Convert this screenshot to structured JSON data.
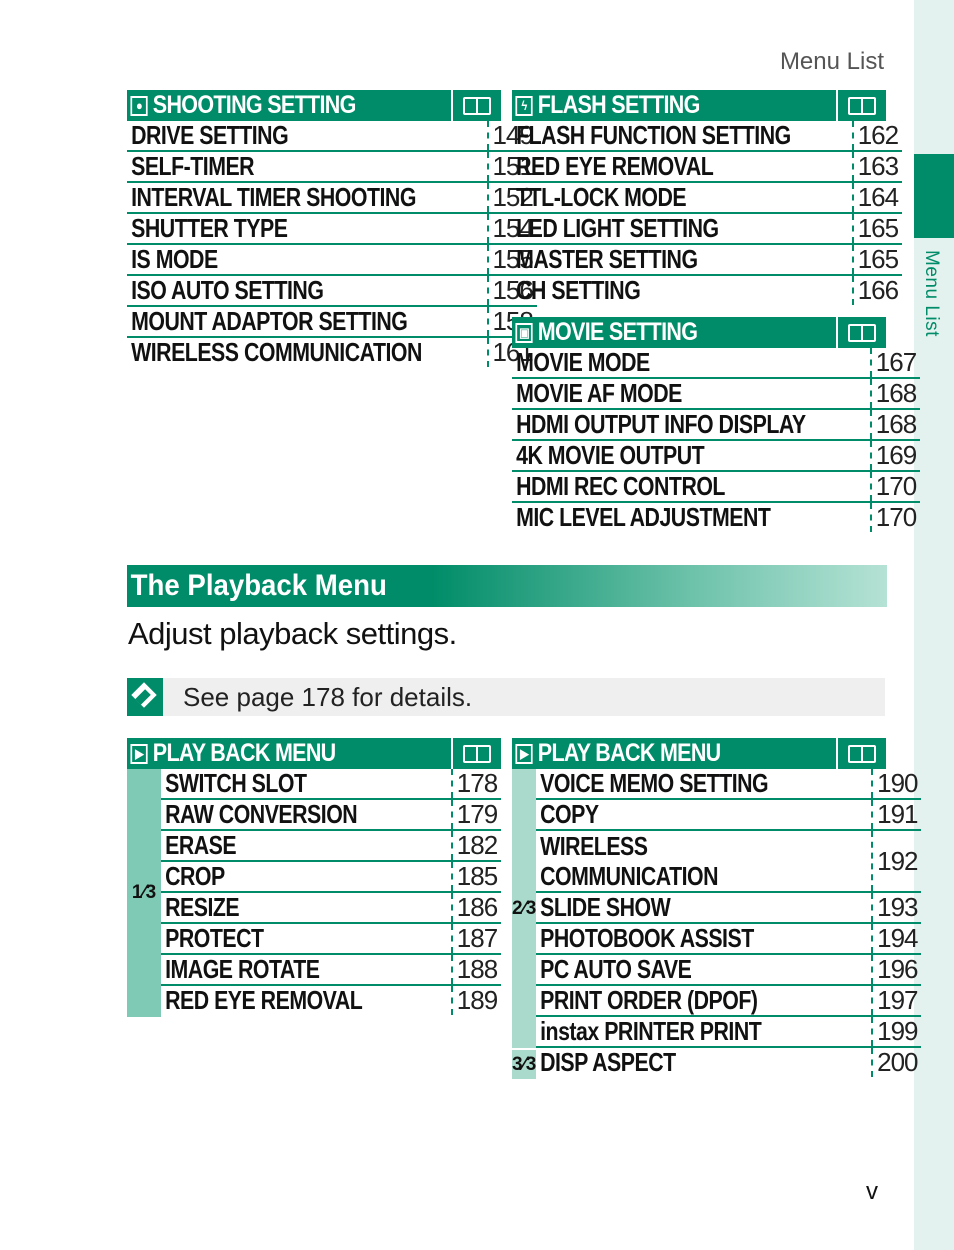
{
  "header": {
    "title": "Menu List"
  },
  "side_tab": {
    "label": "Menu List"
  },
  "page_number": "v",
  "colors": {
    "accent": "#008c68",
    "group_light": "#7fcab4",
    "group_lighter": "#aadacb",
    "side_strip": "#e3f2ee"
  },
  "shooting": {
    "title": "SHOOTING SETTING",
    "icon": "camera-icon",
    "rows": [
      {
        "label": "DRIVE SETTING",
        "page": "149"
      },
      {
        "label": "SELF-TIMER",
        "page": "151"
      },
      {
        "label": "INTERVAL TIMER SHOOTING",
        "page": "152"
      },
      {
        "label": "SHUTTER TYPE",
        "page": "154"
      },
      {
        "label": "IS MODE",
        "page": "155"
      },
      {
        "label": "ISO AUTO SETTING",
        "page": "156"
      },
      {
        "label": "MOUNT ADAPTOR SETTING",
        "page": "158"
      },
      {
        "label": "WIRELESS COMMUNICATION",
        "page": "161"
      }
    ]
  },
  "flash": {
    "title": "FLASH SETTING",
    "icon": "flash-icon",
    "rows": [
      {
        "label": "FLASH FUNCTION SETTING",
        "page": "162"
      },
      {
        "label": "RED EYE REMOVAL",
        "page": "163"
      },
      {
        "label": "TTL-LOCK MODE",
        "page": "164"
      },
      {
        "label": "LED LIGHT SETTING",
        "page": "165"
      },
      {
        "label": "MASTER SETTING",
        "page": "165"
      },
      {
        "label": "CH SETTING",
        "page": "166"
      }
    ]
  },
  "movie": {
    "title": "MOVIE SETTING",
    "icon": "movie-camera-icon",
    "rows": [
      {
        "label": "MOVIE MODE",
        "page": "167"
      },
      {
        "label": "MOVIE AF MODE",
        "page": "168"
      },
      {
        "label": "HDMI OUTPUT INFO DISPLAY",
        "page": "168"
      },
      {
        "label": "4K MOVIE OUTPUT",
        "page": "169"
      },
      {
        "label": "HDMI REC CONTROL",
        "page": "170"
      },
      {
        "label": "MIC LEVEL ADJUSTMENT",
        "page": "170"
      }
    ]
  },
  "playback_section": {
    "title": "The Playback Menu",
    "intro": "Adjust playback settings.",
    "note": "See page 178 for details."
  },
  "playback1": {
    "title": "PLAY BACK MENU",
    "icon": "playback-icon",
    "group": "1⁄3",
    "rows": [
      {
        "label": "SWITCH SLOT",
        "page": "178"
      },
      {
        "label": "RAW CONVERSION",
        "page": "179"
      },
      {
        "label": "ERASE",
        "page": "182"
      },
      {
        "label": "CROP",
        "page": "185"
      },
      {
        "label": "RESIZE",
        "page": "186"
      },
      {
        "label": "PROTECT",
        "page": "187"
      },
      {
        "label": "IMAGE ROTATE",
        "page": "188"
      },
      {
        "label": "RED EYE REMOVAL",
        "page": "189"
      }
    ]
  },
  "playback2": {
    "title": "PLAY BACK MENU",
    "icon": "playback-icon",
    "groups": [
      "2⁄3",
      "3⁄3"
    ],
    "rows": [
      {
        "label": "VOICE MEMO SETTING",
        "page": "190"
      },
      {
        "label": "COPY",
        "page": "191"
      },
      {
        "label": "WIRELESS COMMUNICATION",
        "page": "192"
      },
      {
        "label": "SLIDE SHOW",
        "page": "193"
      },
      {
        "label": "PHOTOBOOK ASSIST",
        "page": "194"
      },
      {
        "label": "PC AUTO SAVE",
        "page": "196"
      },
      {
        "label": "PRINT ORDER (DPOF)",
        "page": "197"
      },
      {
        "label": "instax PRINTER PRINT",
        "page": "199"
      },
      {
        "label": "DISP ASPECT",
        "page": "200"
      }
    ]
  }
}
